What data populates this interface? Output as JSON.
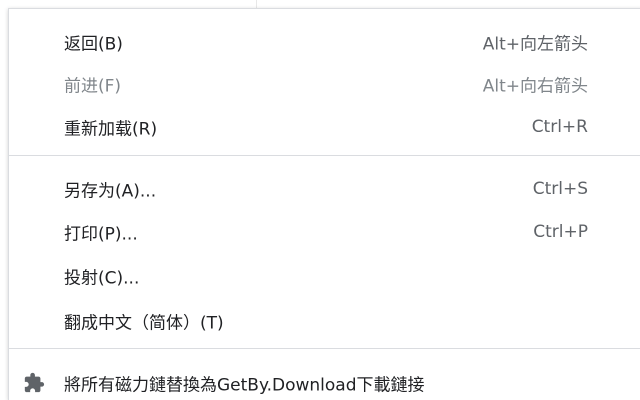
{
  "menu": {
    "items": [
      {
        "label": "返回(B)",
        "accel": "Alt+向左箭头",
        "disabled": false
      },
      {
        "label": "前进(F)",
        "accel": "Alt+向右箭头",
        "disabled": true
      },
      {
        "label": "重新加载(R)",
        "accel": "Ctrl+R",
        "disabled": false
      },
      {
        "label": "另存为(A)...",
        "accel": "Ctrl+S",
        "disabled": false
      },
      {
        "label": "打印(P)...",
        "accel": "Ctrl+P",
        "disabled": false
      },
      {
        "label": "投射(C)...",
        "accel": "",
        "disabled": false
      },
      {
        "label": "翻成中文（简体）(T)",
        "accel": "",
        "disabled": false
      }
    ],
    "extension_item": {
      "label": "將所有磁力鏈替換為GetBy.Download下載鏈接",
      "icon": "puzzle-piece-icon"
    }
  },
  "colors": {
    "text": "#202124",
    "text_disabled": "#80868b",
    "separator": "#dadce0",
    "background": "#ffffff"
  }
}
